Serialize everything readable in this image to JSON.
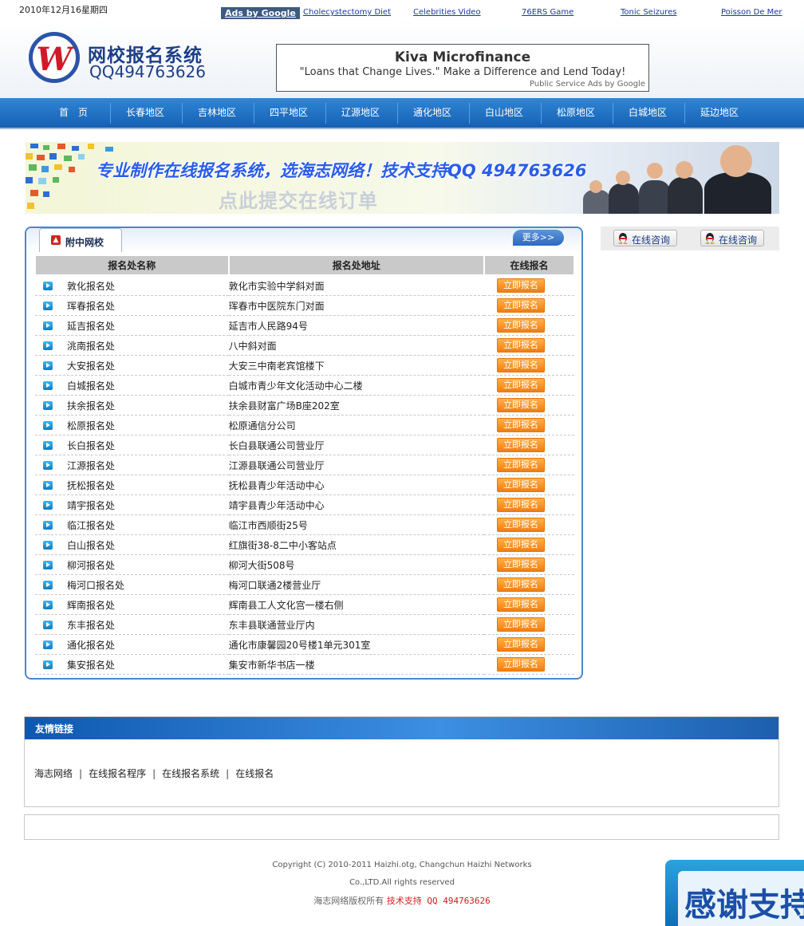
{
  "topbar": {
    "date": "2010年12月16星期四",
    "ads_label": "Ads by Google",
    "ad_links": [
      "Cholecystectomy Diet",
      "Celebrities Video",
      "76ERS Game",
      "Tonic Seizures",
      "Poisson De Mer"
    ]
  },
  "header": {
    "logo_mark": "W",
    "logo_title": "网校报名系统",
    "logo_qq": "QQ494763626",
    "kiva": {
      "title": "Kiva Microfinance",
      "desc": "\"Loans that Change Lives.\" Make a Difference and Lend Today!",
      "foot": "Public Service Ads by Google"
    }
  },
  "nav": [
    "首　页",
    "长春地区",
    "吉林地区",
    "四平地区",
    "辽源地区",
    "通化地区",
    "白山地区",
    "松原地区",
    "白城地区",
    "延边地区"
  ],
  "banner": {
    "line1": "专业制作在线报名系统，选海志网络！技术支持QQ 494763626",
    "line2": "点此提交在线订单"
  },
  "panel": {
    "tab_label": "附中网校",
    "more_label": "更多>>",
    "columns": [
      "报名处名称",
      "报名处地址",
      "在线报名"
    ],
    "signup_label": "立即报名",
    "rows": [
      {
        "name": "敦化报名处",
        "address": "敦化市实验中学斜对面"
      },
      {
        "name": "珲春报名处",
        "address": "珲春市中医院东门对面"
      },
      {
        "name": "延吉报名处",
        "address": "延吉市人民路94号"
      },
      {
        "name": "洮南报名处",
        "address": "八中斜对面"
      },
      {
        "name": "大安报名处",
        "address": "大安三中南老宾馆楼下"
      },
      {
        "name": "白城报名处",
        "address": "白城市青少年文化活动中心二楼"
      },
      {
        "name": "扶余报名处",
        "address": "扶余县财富广场B座202室"
      },
      {
        "name": "松原报名处",
        "address": "松原通信分公司"
      },
      {
        "name": "长白报名处",
        "address": "长白县联通公司营业厅"
      },
      {
        "name": "江源报名处",
        "address": "江源县联通公司营业厅"
      },
      {
        "name": "抚松报名处",
        "address": "抚松县青少年活动中心"
      },
      {
        "name": "靖宇报名处",
        "address": "靖宇县青少年活动中心"
      },
      {
        "name": "临江报名处",
        "address": "临江市西顺街25号"
      },
      {
        "name": "白山报名处",
        "address": "红旗街38-8二中小客站点"
      },
      {
        "name": "柳河报名处",
        "address": "柳河大街508号"
      },
      {
        "name": "梅河口报名处",
        "address": "梅河口联通2楼营业厅"
      },
      {
        "name": "辉南报名处",
        "address": "辉南县工人文化宫一楼右侧"
      },
      {
        "name": "东丰报名处",
        "address": "东丰县联通营业厅内"
      },
      {
        "name": "通化报名处",
        "address": "通化市康馨园20号楼1单元301室"
      },
      {
        "name": "集安报名处",
        "address": "集安市新华书店一楼"
      }
    ]
  },
  "sidebar": {
    "consult_buttons": [
      "在线咨询",
      "在线咨询"
    ]
  },
  "links": {
    "title": "友情链接",
    "items": [
      "海志网络",
      "在线报名程序",
      "在线报名系统",
      "在线报名"
    ],
    "separator": "|"
  },
  "footer": {
    "line1": "Copyright (C) 2010-2011 Haizhi.otg, Changchun Haizhi Networks",
    "line2": "Co.,LTD.All rights reserved",
    "line3_prefix": "海志网络版权所有",
    "line3_support": "技术支持 QQ 494763626"
  },
  "float_ad": {
    "text": "感谢支持"
  },
  "colors": {
    "nav_blue": "#1f6fc4",
    "panel_border": "#4f86c8",
    "signup_orange": "#f58c1e",
    "links_head_blue": "#1d6ac6"
  }
}
